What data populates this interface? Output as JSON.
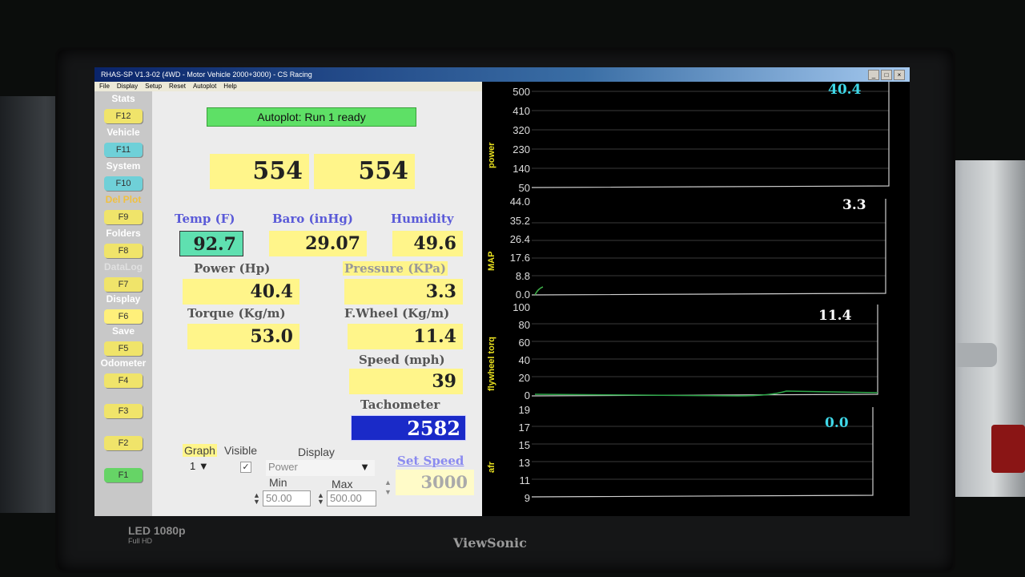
{
  "window": {
    "title": "RHAS-SP V1.3-02  (4WD - Motor Vehicle 2000+3000) - CS Racing"
  },
  "menu": [
    "File",
    "Display",
    "Setup",
    "Reset",
    "Autoplot",
    "Help"
  ],
  "sidebar": [
    {
      "label": "Stats",
      "key": "F12"
    },
    {
      "label": "Vehicle",
      "key": "F11"
    },
    {
      "label": "System",
      "key": "F10"
    },
    {
      "label": "Del Plot",
      "key": "F9"
    },
    {
      "label": "Folders",
      "key": "F8"
    },
    {
      "label": "DataLog",
      "key": "F7"
    },
    {
      "label": "Display",
      "key": "F6"
    },
    {
      "label": "Save",
      "key": "F5"
    },
    {
      "label": "Odometer",
      "key": "F4"
    },
    {
      "label": "",
      "key": "F3"
    },
    {
      "label": "",
      "key": "F2"
    },
    {
      "label": "",
      "key": "F1"
    }
  ],
  "status": {
    "autoplot": "Autoplot: Run 1 ready"
  },
  "readings": {
    "top_left": "554",
    "top_right": "554",
    "temp_label": "Temp (F)",
    "temp": "92.7",
    "baro_label": "Baro (inHg)",
    "baro": "29.07",
    "humidity_label": "Humidity",
    "humidity": "49.6",
    "power_label": "Power (Hp)",
    "power": "40.4",
    "pressure_label": "Pressure (KPa)",
    "pressure": "3.3",
    "torque_label": "Torque (Kg/m)",
    "torque": "53.0",
    "fwheel_label": "F.Wheel (Kg/m)",
    "fwheel": "11.4",
    "speed_label": "Speed (mph)",
    "speed": "39",
    "tach_label": "Tachometer",
    "tach": "2582"
  },
  "graph_panel": {
    "graph_label": "Graph",
    "visible_label": "Visible",
    "display_label": "Display",
    "graph_num": "1",
    "display_value": "Power",
    "min_label": "Min",
    "max_label": "Max",
    "min_value": "50.00",
    "max_value": "500.00",
    "set_speed_label": "Set Speed",
    "set_speed_value": "3000"
  },
  "plots": [
    {
      "name": "power",
      "value": "40.4",
      "value_color": "#3fd8e8",
      "ticks": [
        "500",
        "410",
        "320",
        "230",
        "140",
        "50"
      ]
    },
    {
      "name": "MAP",
      "value": "3.3",
      "value_color": "#ffffff",
      "ticks": [
        "44.0",
        "35.2",
        "26.4",
        "17.6",
        "8.8",
        "0.0"
      ]
    },
    {
      "name": "flywheel torq",
      "value": "11.4",
      "value_color": "#ffffff",
      "ticks": [
        "100",
        "80",
        "60",
        "40",
        "20",
        "0"
      ]
    },
    {
      "name": "afr",
      "value": "0.0",
      "value_color": "#3fd8e8",
      "ticks": [
        "19",
        "17",
        "15",
        "13",
        "11",
        "9"
      ]
    }
  ],
  "monitor": {
    "brand": "ViewSonic",
    "badge": "LED",
    "res": "1080p",
    "res_sub": "Full HD"
  }
}
